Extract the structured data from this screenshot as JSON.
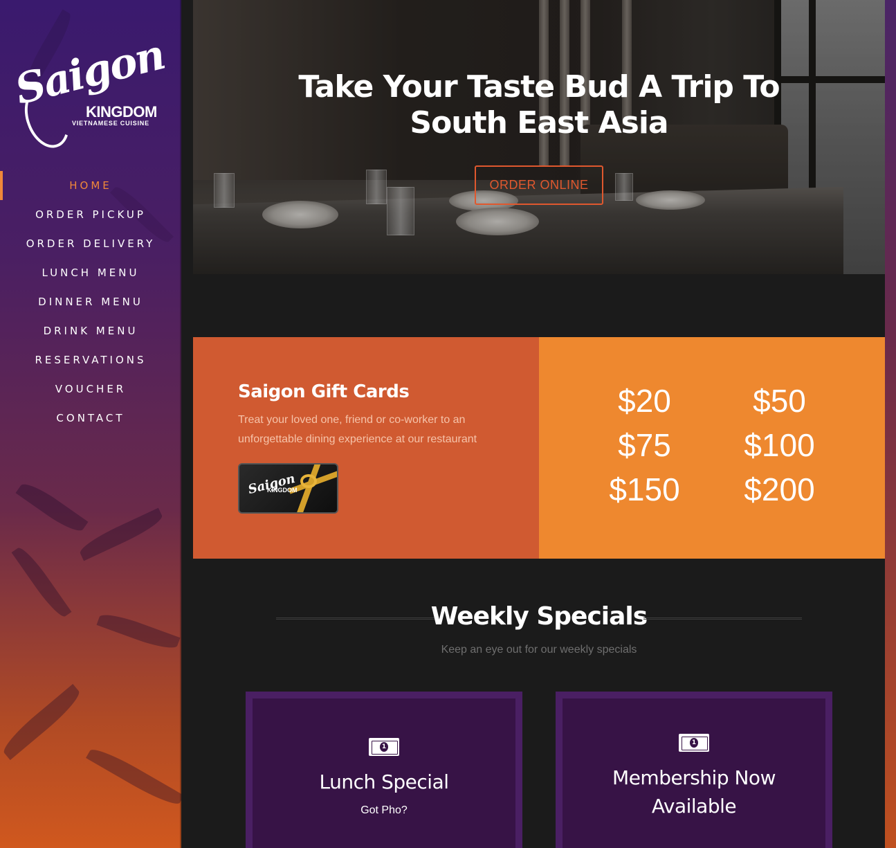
{
  "brand": {
    "logo_script": "Saigon",
    "logo_name": "KINGDOM",
    "logo_tagline": "VIETNAMESE CUISINE"
  },
  "nav": {
    "items": [
      {
        "label": "HOME",
        "active": true
      },
      {
        "label": "ORDER PICKUP",
        "active": false
      },
      {
        "label": "ORDER DELIVERY",
        "active": false
      },
      {
        "label": "LUNCH MENU",
        "active": false
      },
      {
        "label": "DINNER MENU",
        "active": false
      },
      {
        "label": "DRINK MENU",
        "active": false
      },
      {
        "label": "RESERVATIONS",
        "active": false
      },
      {
        "label": "VOUCHER",
        "active": false
      },
      {
        "label": "CONTACT",
        "active": false
      }
    ]
  },
  "hero": {
    "title": "Take Your Taste Bud A Trip To South East Asia",
    "button_label": "ORDER ONLINE"
  },
  "gift": {
    "title": "Saigon Gift Cards",
    "description": "Treat your loved one, friend or co-worker to an unforgettable dining experience at our restaurant",
    "card_logo": "Saigon",
    "card_name": "KINGDOM",
    "amounts": [
      "$20",
      "$50",
      "$75",
      "$100",
      "$150",
      "$200"
    ]
  },
  "specials": {
    "title": "Weekly Specials",
    "subtitle": "Keep an eye out for our weekly specials",
    "cards": [
      {
        "icon": "money-bill-icon",
        "title": "Lunch Special",
        "subtitle": "Got Pho?"
      },
      {
        "icon": "money-bill-icon",
        "title": "Membership Now Available",
        "subtitle": ""
      }
    ]
  },
  "colors": {
    "accent": "#f0883a",
    "gift_left_bg": "#d05a31",
    "gift_right_bg": "#ee882f",
    "card_border": "#4a1f63",
    "card_bg": "#371346",
    "button_outline": "#e0582e",
    "page_bg": "#1b1b1b"
  }
}
